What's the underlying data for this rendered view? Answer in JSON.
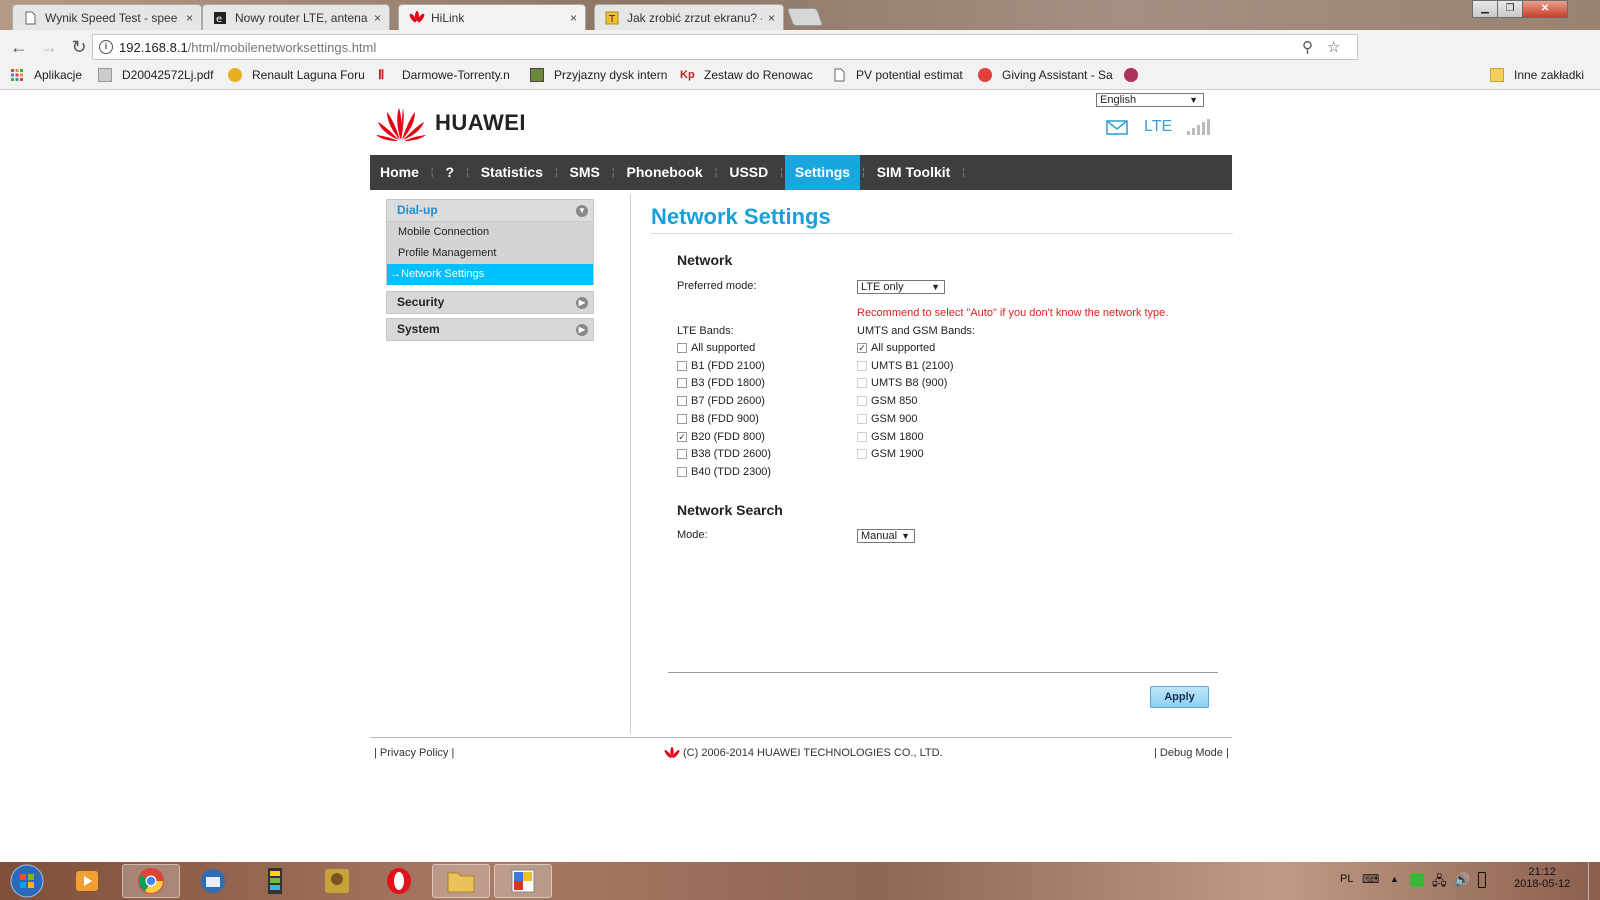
{
  "browser": {
    "tabs": [
      {
        "title": "Wynik Speed Test - spee",
        "close": "×"
      },
      {
        "title": "Nowy router LTE, antena",
        "close": "×"
      },
      {
        "title": "HiLink",
        "close": "×"
      },
      {
        "title": "Jak zrobić zrzut ekranu? -",
        "close": "×"
      }
    ],
    "url_host": "192.168.8.1",
    "url_path": "/html/mobilenetworksettings.html",
    "bookmarks": [
      "Aplikacje",
      "D20042572Lj.pdf",
      "Renault Laguna Foru",
      "Darmowe-Torrenty.n",
      "Przyjazny dysk intern",
      "Zestaw do Renowac",
      "PV potential estimat",
      "Giving Assistant - Sa"
    ],
    "other_bookmarks": "Inne zakładki"
  },
  "header": {
    "language": "English",
    "brand": "HUAWEI",
    "network_type": "LTE"
  },
  "nav": {
    "items": [
      "Home",
      "?",
      "Statistics",
      "SMS",
      "Phonebook",
      "USSD",
      "Settings",
      "SIM Toolkit"
    ],
    "active": "Settings"
  },
  "sidebar": {
    "dialup": "Dial-up",
    "dialup_items": [
      "Mobile Connection",
      "Profile Management",
      "Network Settings"
    ],
    "active_prefix": "→",
    "security": "Security",
    "system": "System"
  },
  "content": {
    "title": "Network Settings",
    "network_heading": "Network",
    "preferred_mode_label": "Preferred mode:",
    "preferred_mode_value": "LTE only",
    "recommend": "Recommend to select \"Auto\" if you don't know the network type.",
    "lte_bands_label": "LTE Bands:",
    "umts_bands_label": "UMTS and GSM Bands:",
    "lte_bands": [
      {
        "label": "All supported",
        "checked": false
      },
      {
        "label": "B1 (FDD 2100)",
        "checked": false
      },
      {
        "label": "B3 (FDD 1800)",
        "checked": false
      },
      {
        "label": "B7 (FDD 2600)",
        "checked": false
      },
      {
        "label": "B8 (FDD 900)",
        "checked": false
      },
      {
        "label": "B20 (FDD 800)",
        "checked": true
      },
      {
        "label": "B38 (TDD 2600)",
        "checked": false
      },
      {
        "label": "B40 (TDD 2300)",
        "checked": false
      }
    ],
    "umts_bands": [
      {
        "label": "All supported",
        "checked": true
      },
      {
        "label": "UMTS B1 (2100)",
        "checked": false
      },
      {
        "label": "UMTS B8 (900)",
        "checked": false
      },
      {
        "label": "GSM 850",
        "checked": false
      },
      {
        "label": "GSM 900",
        "checked": false
      },
      {
        "label": "GSM 1800",
        "checked": false
      },
      {
        "label": "GSM 1900",
        "checked": false
      }
    ],
    "search_heading": "Network Search",
    "mode_label": "Mode:",
    "mode_value": "Manual",
    "apply": "Apply"
  },
  "footer": {
    "privacy": "Privacy Policy",
    "copyright": "(C) 2006-2014 HUAWEI TECHNOLOGIES CO., LTD.",
    "debug": "Debug Mode"
  },
  "taskbar": {
    "lang": "PL",
    "time": "21:12",
    "date": "2018-05-12"
  },
  "colors": {
    "accent": "#1aa7e0",
    "nav_bg": "#3e3e3e",
    "warning": "#e02020",
    "huawei_red": "#e60012"
  }
}
